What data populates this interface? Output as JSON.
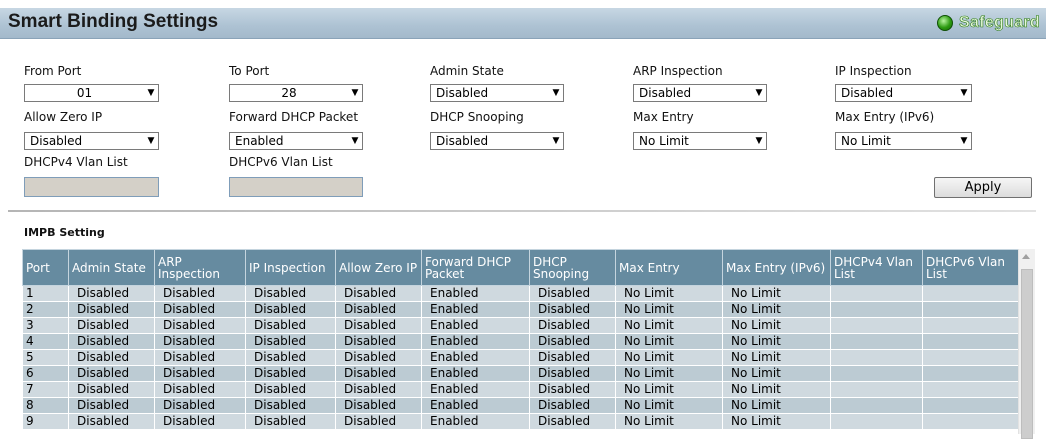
{
  "header": {
    "title": "Smart Binding Settings",
    "brand": "Safeguard",
    "brand_color": "#3aa01e"
  },
  "form": {
    "from_port": {
      "label": "From Port",
      "value": "01"
    },
    "to_port": {
      "label": "To Port",
      "value": "28"
    },
    "admin_state": {
      "label": "Admin State",
      "value": "Disabled"
    },
    "arp_inspection": {
      "label": "ARP Inspection",
      "value": "Disabled"
    },
    "ip_inspection": {
      "label": "IP Inspection",
      "value": "Disabled"
    },
    "allow_zero_ip": {
      "label": "Allow Zero IP",
      "value": "Disabled"
    },
    "forward_dhcp_packet": {
      "label": "Forward DHCP Packet",
      "value": "Enabled"
    },
    "dhcp_snooping": {
      "label": "DHCP Snooping",
      "value": "Disabled"
    },
    "max_entry": {
      "label": "Max Entry",
      "value": "No Limit"
    },
    "max_entry_ipv6": {
      "label": "Max Entry (IPv6)",
      "value": "No Limit"
    },
    "dhcpv4_vlan_list": {
      "label": "DHCPv4 Vlan List",
      "value": ""
    },
    "dhcpv6_vlan_list": {
      "label": "DHCPv6 Vlan List",
      "value": ""
    },
    "apply_label": "Apply"
  },
  "impb": {
    "section_title": "IMPB Setting",
    "columns": [
      "Port",
      "Admin State",
      "ARP Inspection",
      "IP Inspection",
      "Allow Zero IP",
      "Forward DHCP Packet",
      "DHCP Snooping",
      "Max Entry",
      "Max Entry (IPv6)",
      "DHCPv4 Vlan List",
      "DHCPv6 Vlan List"
    ],
    "rows": [
      [
        "1",
        "Disabled",
        "Disabled",
        "Disabled",
        "Disabled",
        "Enabled",
        "Disabled",
        "No Limit",
        "No Limit",
        "",
        ""
      ],
      [
        "2",
        "Disabled",
        "Disabled",
        "Disabled",
        "Disabled",
        "Enabled",
        "Disabled",
        "No Limit",
        "No Limit",
        "",
        ""
      ],
      [
        "3",
        "Disabled",
        "Disabled",
        "Disabled",
        "Disabled",
        "Enabled",
        "Disabled",
        "No Limit",
        "No Limit",
        "",
        ""
      ],
      [
        "4",
        "Disabled",
        "Disabled",
        "Disabled",
        "Disabled",
        "Enabled",
        "Disabled",
        "No Limit",
        "No Limit",
        "",
        ""
      ],
      [
        "5",
        "Disabled",
        "Disabled",
        "Disabled",
        "Disabled",
        "Enabled",
        "Disabled",
        "No Limit",
        "No Limit",
        "",
        ""
      ],
      [
        "6",
        "Disabled",
        "Disabled",
        "Disabled",
        "Disabled",
        "Enabled",
        "Disabled",
        "No Limit",
        "No Limit",
        "",
        ""
      ],
      [
        "7",
        "Disabled",
        "Disabled",
        "Disabled",
        "Disabled",
        "Enabled",
        "Disabled",
        "No Limit",
        "No Limit",
        "",
        ""
      ],
      [
        "8",
        "Disabled",
        "Disabled",
        "Disabled",
        "Disabled",
        "Enabled",
        "Disabled",
        "No Limit",
        "No Limit",
        "",
        ""
      ],
      [
        "9",
        "Disabled",
        "Disabled",
        "Disabled",
        "Disabled",
        "Enabled",
        "Disabled",
        "No Limit",
        "No Limit",
        "",
        ""
      ]
    ]
  },
  "colors": {
    "header_bg": "#adc2d3",
    "table_header_bg": "#668ba0",
    "row_odd": "#cfd9df",
    "row_even": "#bccbd3"
  },
  "icons": {
    "status": "green-dot-icon",
    "dropdown": "triangle-down-icon",
    "scroll_up": "triangle-up-icon"
  }
}
